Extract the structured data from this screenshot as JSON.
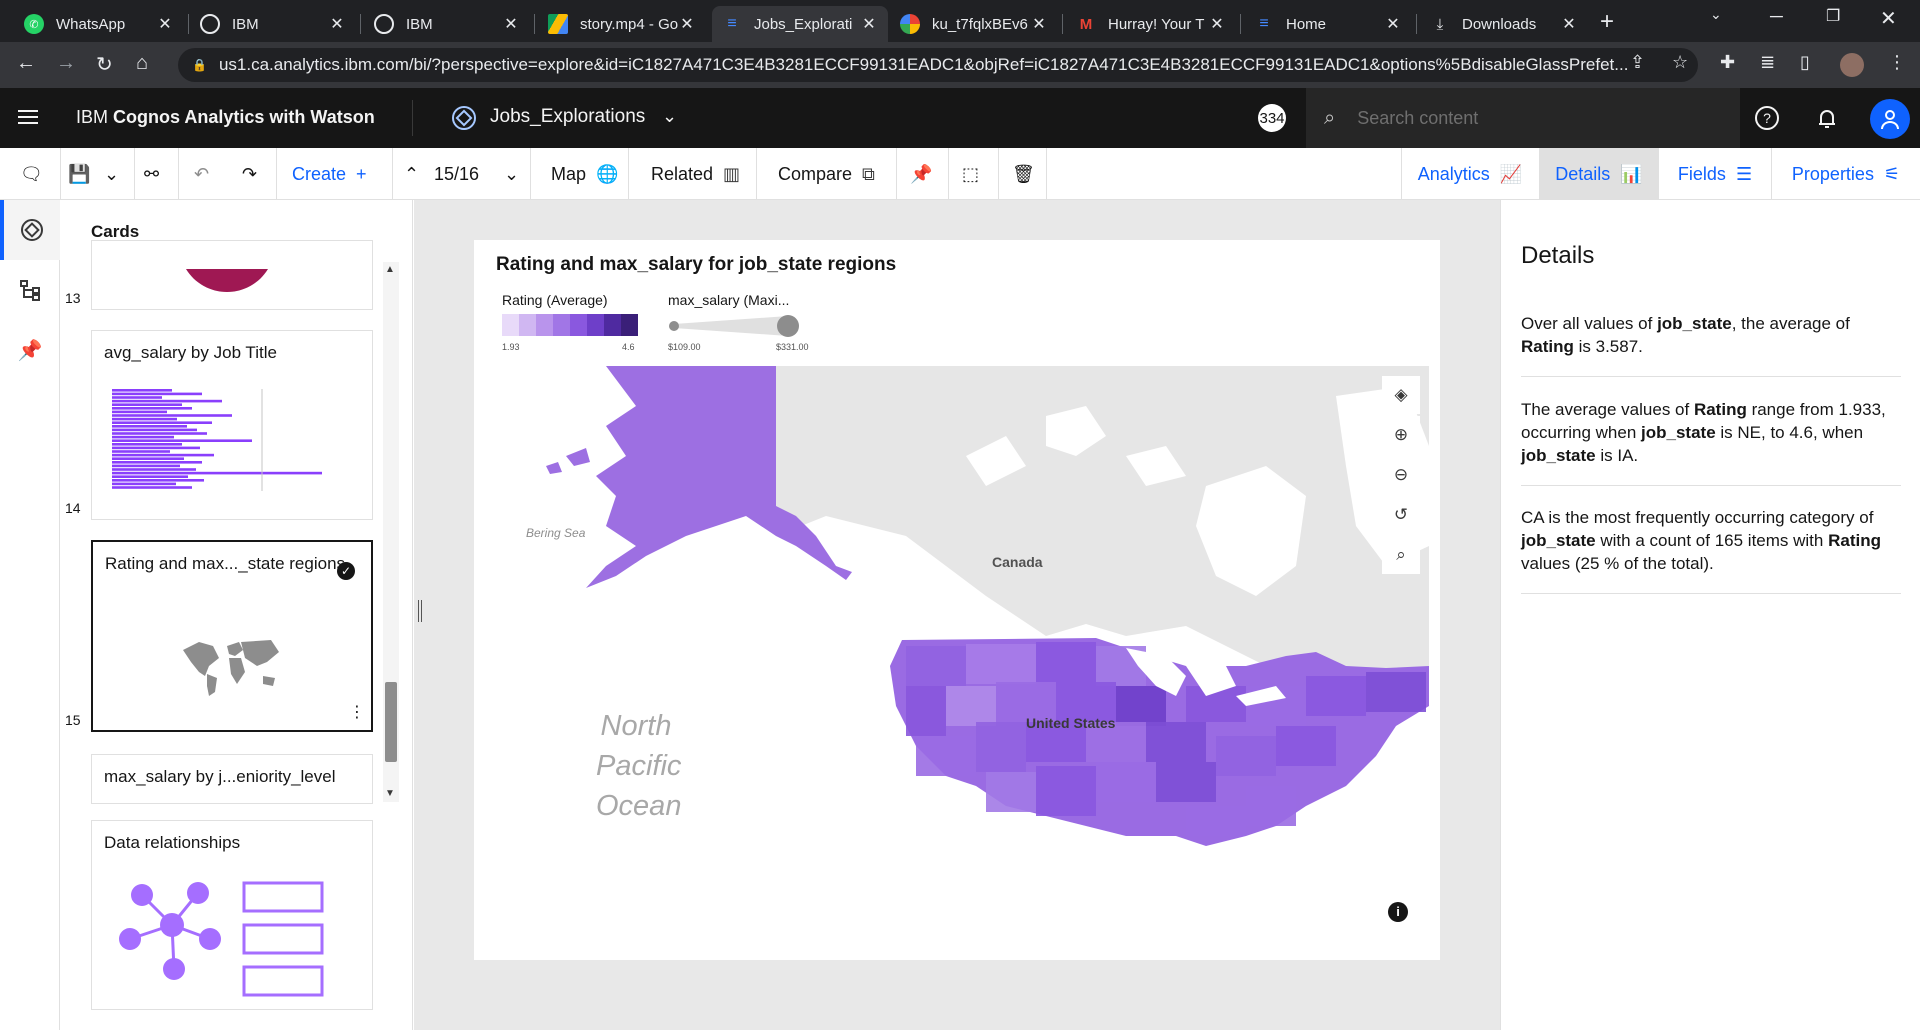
{
  "browser": {
    "tabs": [
      {
        "title": "WhatsApp",
        "icon": "whatsapp-icon",
        "color": "#25d366"
      },
      {
        "title": "IBM",
        "icon": "globe-icon",
        "color": "#e8eaed"
      },
      {
        "title": "IBM",
        "icon": "globe-icon",
        "color": "#e8eaed"
      },
      {
        "title": "story.mp4 - Go",
        "icon": "google-drive-icon",
        "color": "#fbbc04"
      },
      {
        "title": "Jobs_Explorati",
        "icon": "cognos-icon",
        "color": "#4589ff"
      },
      {
        "title": "ku_t7fqlxBEv6",
        "icon": "pinwheel-icon",
        "color": "#ea4335"
      },
      {
        "title": "Hurray! Your T",
        "icon": "gmail-icon",
        "color": "#ea4335"
      },
      {
        "title": "Home",
        "icon": "cognos-icon",
        "color": "#4589ff"
      },
      {
        "title": "Downloads",
        "icon": "download-icon",
        "color": "#e8eaed"
      }
    ],
    "url": "us1.ca.analytics.ibm.com/bi/?perspective=explore&id=iC1827A471C3E4B3281ECCF99131EADC1&objRef=iC1827A471C3E4B3281ECCF99131EADC1&options%5BdisableGlassPrefet..."
  },
  "header": {
    "brand_prefix": "IBM",
    "brand_name": "Cognos Analytics with Watson",
    "workspace": "Jobs_Explorations",
    "badge": "334",
    "search_placeholder": "Search content"
  },
  "toolbar": {
    "create": "Create",
    "page": "15/16",
    "map": "Map",
    "related": "Related",
    "compare": "Compare",
    "tabs": {
      "analytics": "Analytics",
      "details": "Details",
      "fields": "Fields",
      "properties": "Properties"
    }
  },
  "cards": {
    "title": "Cards",
    "items": [
      {
        "num": "13",
        "title": ""
      },
      {
        "num": "14",
        "title": "avg_salary by Job Title"
      },
      {
        "num": "15",
        "title": "Rating and max..._state regions"
      },
      {
        "num": "",
        "title": "max_salary by j...eniority_level"
      },
      {
        "num": "",
        "title": "Data relationships"
      }
    ]
  },
  "viz": {
    "title": "Rating and max_salary for job_state regions",
    "legend_color": {
      "label": "Rating (Average)",
      "min": "1.93",
      "max": "4.6"
    },
    "legend_size": {
      "label": "max_salary (Maxi...",
      "min": "$109.00",
      "max": "$331.00"
    },
    "map_labels": {
      "bering": "Bering Sea",
      "canada": "Canada",
      "us": "United States",
      "ocean": "North\nPacific\nOcean"
    },
    "colors": [
      "#e8daf9",
      "#d0b7f2",
      "#b994ec",
      "#a176e6",
      "#8a58df",
      "#6e3fc9",
      "#4f2aa0",
      "#3a1f78"
    ]
  },
  "details": {
    "title": "Details",
    "p1": {
      "a": "Over all values of ",
      "b": "job_state",
      "c": ", the average of ",
      "d": "Rating",
      "e": " is 3.587."
    },
    "p2": {
      "a": "The average values of ",
      "b": "Rating",
      "c": " range from 1.933, occurring when ",
      "d": "job_state",
      "e": " is NE, to 4.6, when ",
      "f": "job_state",
      "g": " is IA."
    },
    "p3": {
      "a": "CA is the most frequently occurring category of ",
      "b": "job_state",
      "c": " with a count of 165 items with ",
      "d": "Rating",
      "e": " values (25 % of the total)."
    }
  }
}
